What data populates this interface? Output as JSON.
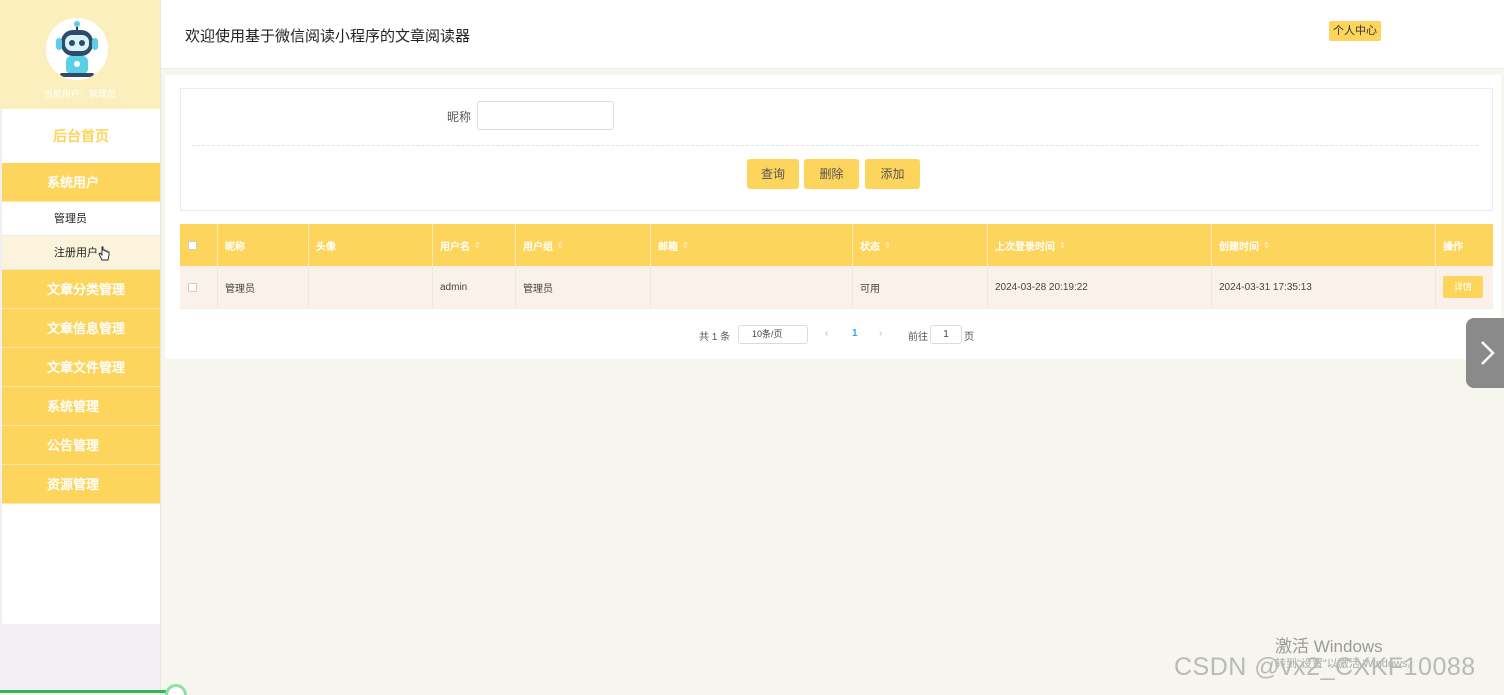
{
  "sidebar": {
    "current_user": "当前用户：管理员",
    "home_label": "后台首页",
    "group_system_users": "系统用户",
    "sub_admin": "管理员",
    "sub_registered": "注册用户",
    "group_article_category": "文章分类管理",
    "group_article_info": "文章信息管理",
    "group_article_file": "文章文件管理",
    "group_system_manage": "系统管理",
    "group_notice": "公告管理",
    "group_resource": "资源管理"
  },
  "header": {
    "title": "欢迎使用基于微信阅读小程序的文章阅读器",
    "profile_button": "个人中心"
  },
  "search": {
    "nickname_label": "昵称",
    "nickname_value": "",
    "query_button": "查询",
    "delete_button": "删除",
    "add_button": "添加"
  },
  "table": {
    "columns": [
      "昵称",
      "头像",
      "用户名",
      "用户组",
      "邮箱",
      "状态",
      "上次登录时间",
      "创建时间",
      "操作"
    ],
    "rows": [
      {
        "nickname": "管理员",
        "avatar": "",
        "username": "admin",
        "group": "管理员",
        "email": "",
        "status": "可用",
        "last_login": "2024-03-28 20:19:22",
        "created": "2024-03-31 17:35:13",
        "action": "详情"
      }
    ]
  },
  "pagination": {
    "total": "共 1 条",
    "page_size": "10条/页",
    "current_page": "1",
    "goto_label": "前往",
    "goto_value": "1",
    "page_unit": "页"
  },
  "watermark": {
    "activate_title": "激活 Windows",
    "activate_sub": "转到\"设置\"以激活 Windows。",
    "csdn": "CSDN @vx2_CXKF10088"
  },
  "colors": {
    "accent": "#fdd45c",
    "sidebar_head": "#fbefbe",
    "row_bg": "#f9f1ea"
  }
}
